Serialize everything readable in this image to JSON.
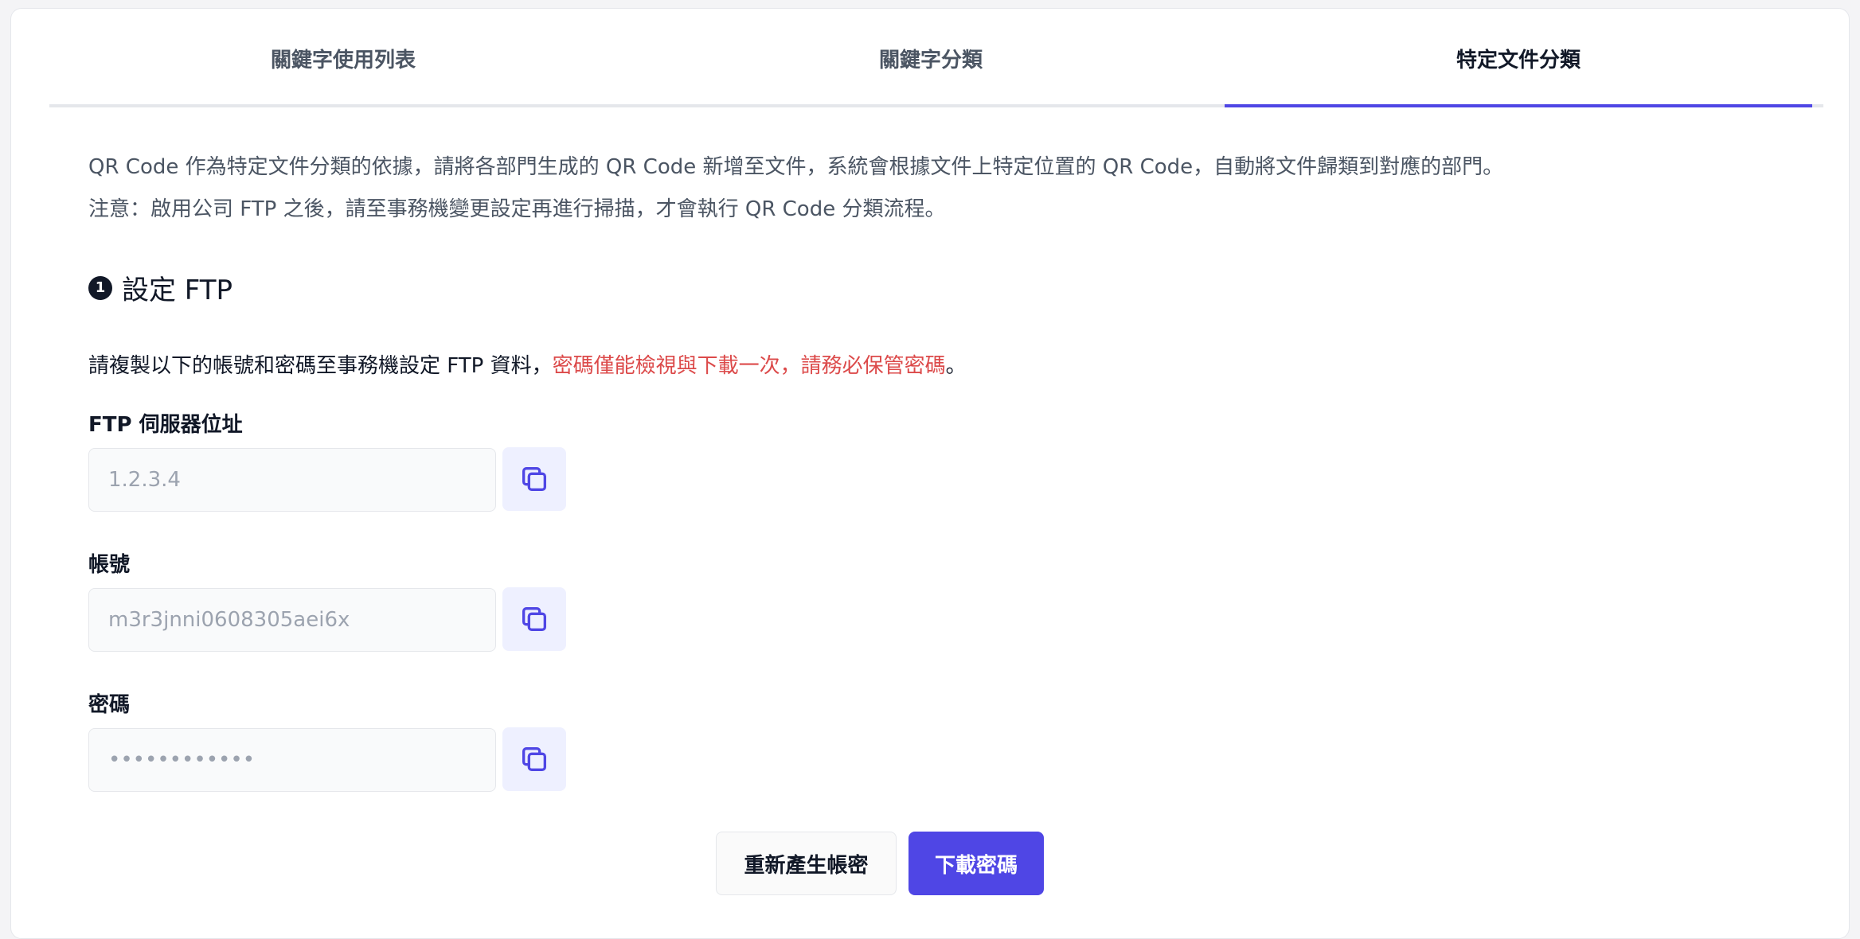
{
  "tabs": [
    {
      "label": "關鍵字使用列表"
    },
    {
      "label": "關鍵字分類"
    },
    {
      "label": "特定文件分類",
      "active": true
    }
  ],
  "description": {
    "line1": "QR Code 作為特定文件分類的依據，請將各部門生成的 QR Code 新增至文件，系統會根據文件上特定位置的 QR Code，自動將文件歸類到對應的部門。",
    "line2": "注意：啟用公司 FTP 之後，請至事務機變更設定再進行掃描，才會執行 QR Code 分類流程。"
  },
  "section": {
    "number": "1",
    "title": "設定 FTP"
  },
  "instruction": {
    "text": "請複製以下的帳號和密碼至事務機設定 FTP 資料，",
    "warning": "密碼僅能檢視與下載一次，請務必保管密碼",
    "end": "。"
  },
  "fields": {
    "server": {
      "label": "FTP 伺服器位址",
      "value": "1.2.3.4"
    },
    "account": {
      "label": "帳號",
      "value": "m3r3jnni0608305aei6x"
    },
    "password": {
      "label": "密碼",
      "value": "••••••••••••"
    }
  },
  "buttons": {
    "regenerate": "重新產生帳密",
    "download": "下載密碼"
  },
  "colors": {
    "accent": "#4f46e5",
    "warning": "#dc4a4a",
    "copy_bg": "#eef0ff"
  },
  "icons": {
    "copy": "copy-icon"
  }
}
